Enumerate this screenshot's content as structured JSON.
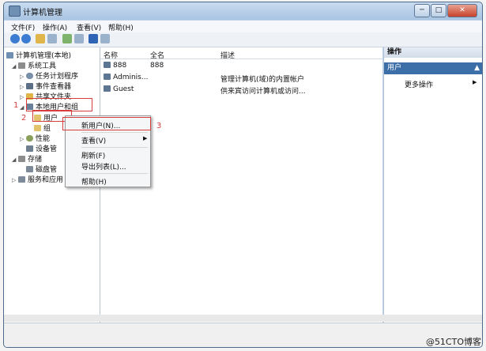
{
  "window": {
    "title": "计算机管理",
    "minimize": "─",
    "maximize": "□",
    "close": "✕"
  },
  "menu": [
    "文件(F)",
    "操作(A)",
    "查看(V)",
    "帮助(H)"
  ],
  "tree": {
    "root": "计算机管理(本地)",
    "system_tools": "系统工具",
    "task_scheduler": "任务计划程序",
    "event_viewer": "事件查看器",
    "shared_folders": "共享文件夹",
    "local_users": "本地用户和组",
    "users": "用户",
    "groups": "组",
    "performance": "性能",
    "device_manager": "设备管",
    "storage": "存储",
    "disk_mgmt": "磁盘管",
    "services": "服务和应用"
  },
  "list": {
    "columns": [
      "名称",
      "全名",
      "描述"
    ],
    "rows": [
      {
        "name": "888",
        "fullname": "888",
        "desc": ""
      },
      {
        "name": "Adminis...",
        "fullname": "",
        "desc": "管理计算机(域)的内置帐户"
      },
      {
        "name": "Guest",
        "fullname": "",
        "desc": "供来宾访问计算机或访问..."
      }
    ]
  },
  "actions": {
    "header": "操作",
    "selected": "用户",
    "more": "更多操作"
  },
  "context_menu": {
    "new_user": "新用户(N)...",
    "view": "查看(V)",
    "refresh": "刷新(F)",
    "export": "导出列表(L)...",
    "help": "帮助(H)"
  },
  "annotations": [
    "1",
    "2",
    "3"
  ],
  "watermark": "@51CTO博客",
  "colors": {
    "accent": "#3c6ea8",
    "annotation": "#d63d3d"
  }
}
